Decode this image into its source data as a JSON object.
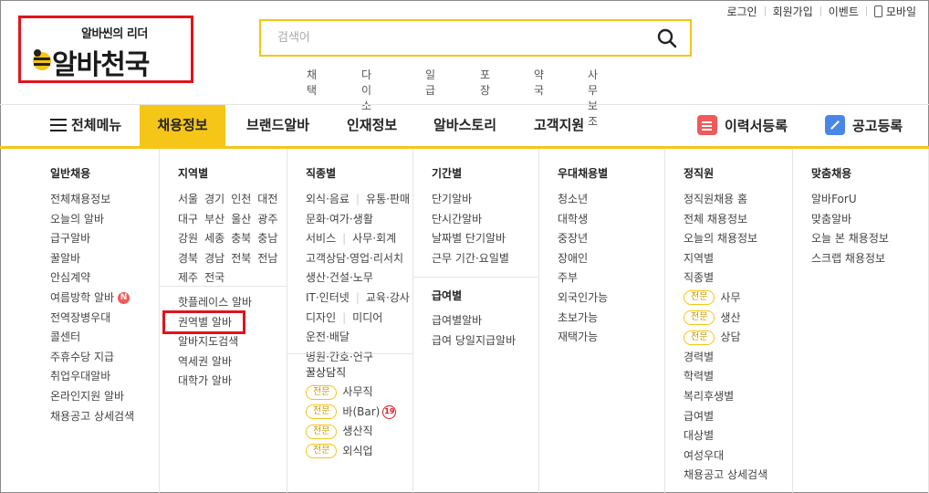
{
  "logo": {
    "tagline": "알바씬의 리더",
    "name": "알바천국"
  },
  "search": {
    "placeholder": "검색어",
    "keywords": [
      "채택",
      "다이소",
      "일급",
      "포장",
      "약국",
      "사무보조"
    ]
  },
  "util": {
    "login": "로그인",
    "signup": "회원가입",
    "event": "이벤트",
    "mobile": "모바일"
  },
  "nav": {
    "all_menu": "전체메뉴",
    "items": [
      "채용정보",
      "브랜드알바",
      "인재정보",
      "알바스토리",
      "고객지원"
    ],
    "resume": "이력서등록",
    "post": "공고등록"
  },
  "menu": {
    "general": {
      "title": "일반채용",
      "items": [
        "전체채용정보",
        "오늘의 알바",
        "급구알바",
        "꿀알바",
        "안심계약",
        "여름방학 알바",
        "전역장병우대",
        "콜센터",
        "주휴수당 지급",
        "취업우대알바",
        "온라인지원 알바",
        "채용공고 상세검색"
      ],
      "new_badge": "N"
    },
    "region": {
      "title": "지역별",
      "rows": [
        [
          "서울",
          "경기",
          "인천",
          "대전"
        ],
        [
          "대구",
          "부산",
          "울산",
          "광주"
        ],
        [
          "강원",
          "세종",
          "충북",
          "충남"
        ],
        [
          "경북",
          "경남",
          "전북",
          "전남"
        ],
        [
          "제주",
          "전국"
        ]
      ],
      "extra": [
        "핫플레이스 알바",
        "권역별 알바",
        "알바지도검색",
        "역세권 알바",
        "대학가 알바"
      ]
    },
    "job": {
      "title": "직종별",
      "rows": [
        [
          "외식·음료",
          "유통·판매"
        ],
        [
          "문화·여가·생활"
        ],
        [
          "서비스",
          "사무·회계"
        ],
        [
          "고객상담·영업·리서치"
        ],
        [
          "생산·건설·노무"
        ],
        [
          "IT·인터넷",
          "교육·강사"
        ],
        [
          "디자인",
          "미디어"
        ],
        [
          "운전·배달"
        ],
        [
          "병원·간호·연구"
        ]
      ],
      "honey_title": "꿀상담직",
      "pill": "전문",
      "honey": [
        "사무직",
        "바(Bar)",
        "생산직",
        "외식업"
      ],
      "adult_badge": "19"
    },
    "period": {
      "title": "기간별",
      "items": [
        "단기알바",
        "단시간알바",
        "날짜별 단기알바",
        "근무 기간·요일별"
      ],
      "pay_title": "급여별",
      "pay_items": [
        "급여별알바",
        "급여 당일지급알바"
      ]
    },
    "preferred": {
      "title": "우대채용별",
      "items": [
        "청소년",
        "대학생",
        "중장년",
        "장애인",
        "주부",
        "외국인가능",
        "초보가능",
        "재택가능"
      ]
    },
    "regular": {
      "title": "정직원",
      "items": [
        "정직원채용 홈",
        "전체 채용정보",
        "오늘의 채용정보",
        "지역별",
        "직종별"
      ],
      "pill": "전문",
      "pill_items": [
        "사무",
        "생산",
        "상담"
      ],
      "items2": [
        "경력별",
        "학력별",
        "복리후생별",
        "급여별",
        "대상별",
        "여성우대",
        "채용공고 상세검색"
      ]
    },
    "custom": {
      "title": "맞춤채용",
      "items": [
        "알바ForU",
        "맞춤알바",
        "오늘 본 채용정보",
        "스크랩 채용정보"
      ]
    }
  },
  "colors": {
    "accent": "#f5c518",
    "highlight": "#e0141c"
  }
}
